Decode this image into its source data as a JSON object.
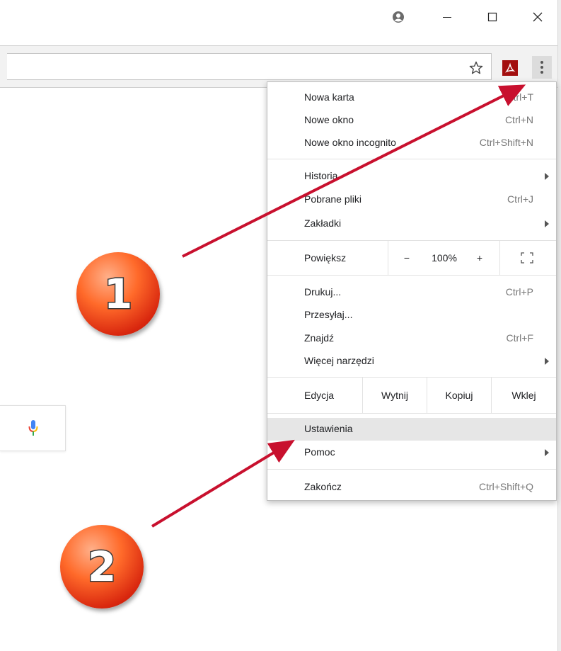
{
  "window": {
    "controls": [
      "account-icon",
      "minimize-icon",
      "maximize-icon",
      "close-icon"
    ]
  },
  "toolbar": {
    "icons": [
      "star-icon",
      "adobe-pdf-icon",
      "kebab-menu-icon"
    ]
  },
  "colors": {
    "accent_red": "#c8102e",
    "badge_orange": "#ff6a2a",
    "highlight_gray": "#e6e6e6"
  },
  "menu": {
    "new_tab": {
      "label": "Nowa karta",
      "shortcut": "Ctrl+T"
    },
    "new_window": {
      "label": "Nowe okno",
      "shortcut": "Ctrl+N"
    },
    "incognito": {
      "label": "Nowe okno incognito",
      "shortcut": "Ctrl+Shift+N"
    },
    "history": {
      "label": "Historia"
    },
    "downloads": {
      "label": "Pobrane pliki",
      "shortcut": "Ctrl+J"
    },
    "bookmarks": {
      "label": "Zakładki"
    },
    "zoom": {
      "label": "Powiększ",
      "minus": "−",
      "value": "100%",
      "plus": "+"
    },
    "print": {
      "label": "Drukuj...",
      "shortcut": "Ctrl+P"
    },
    "cast": {
      "label": "Przesyłaj..."
    },
    "find": {
      "label": "Znajdź",
      "shortcut": "Ctrl+F"
    },
    "more_tools": {
      "label": "Więcej narzędzi"
    },
    "edit": {
      "label": "Edycja",
      "cut": "Wytnij",
      "copy": "Kopiuj",
      "paste": "Wklej"
    },
    "settings": {
      "label": "Ustawienia"
    },
    "help": {
      "label": "Pomoc"
    },
    "exit": {
      "label": "Zakończ",
      "shortcut": "Ctrl+Shift+Q"
    }
  },
  "annotations": {
    "badge1": "1",
    "badge2": "2"
  }
}
